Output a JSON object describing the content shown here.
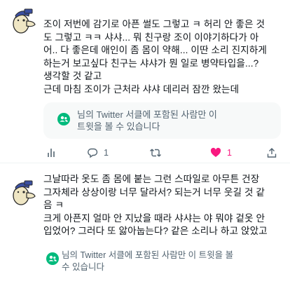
{
  "tweets": [
    {
      "lines": [
        "조이 저번에 감기로 아픈 썰도 그렇고 ㅋ 허리 안 좋은 것",
        "도 그렇고 ㅋㅋ 샤샤... 뭐 친구랑 조이 이야기하다가 아",
        "어.. 다 좋은데 애인이 좀 몸이 약해... 이딴 소리 진지하게",
        "하는거 보고싶다 친구는 샤샤가 뭔 일로 병약타입을...?",
        "생각할 것 같고",
        "근데 마침 조이가 근처라 샤샤 데리러 잠깐 왔는데"
      ],
      "quote_notice": {
        "line1": "님의 Twitter 서클에 포함된 사람만 이",
        "line2": "트윗을 볼 수 있습니다"
      },
      "actions": {
        "stats_count": "",
        "reply_count": "1",
        "retweet_count": "",
        "like_count": "1",
        "liked": true
      }
    },
    {
      "lines": [
        "그날따라 옷도 좀 몸에 붙는 그런 스따일로 아무튼 건장",
        "그자체라 상상이랑 너무 달라서? 되는거 너무 웃길 것 같",
        "음 ㅋ",
        "크게 아픈지 얼마 안 지났을 때라 샤샤는 야 뭐야 겉옷 안",
        "입었어? 그러다 또 앓아눕는다? 같은 소리나 하고 앉았고"
      ],
      "hidden_notice": {
        "line1": "님의 Twitter 서클에 포함된 사람만 이 트윗을 볼",
        "line2": "수 있습니다"
      }
    }
  ],
  "colors": {
    "circle_green": "#00ba7c",
    "like_pink": "#f91880",
    "muted": "#536471",
    "avatar_hat": "#3b4fa0"
  }
}
